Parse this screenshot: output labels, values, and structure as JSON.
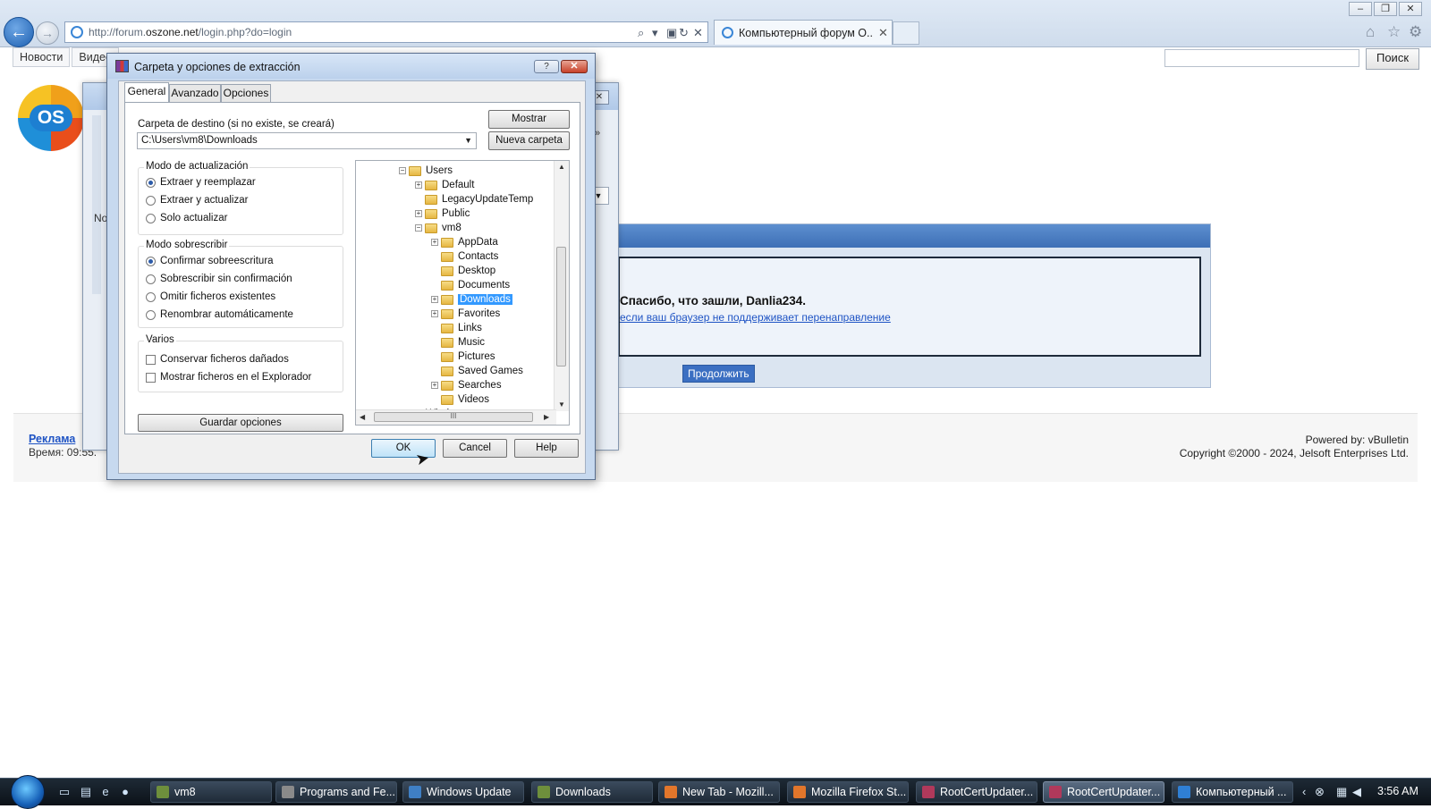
{
  "browser": {
    "url_prefix": "http://forum.",
    "url_domain": "oszone.net",
    "url_path": "/login.php?do=login",
    "tab_title": "Компьютерный форум О...",
    "tab_close": "✕"
  },
  "site": {
    "nav_items": [
      "Новости",
      "Видео"
    ],
    "search_button": "Поиск",
    "logo_text": "OS",
    "thanks_text": "Спасибо, что зашли, Danlia234.",
    "redirect_link": "если ваш браузер не поддерживает перенаправление",
    "continue_button": "Продолжить",
    "footer_ad": "Реклама",
    "footer_time": "Время: 09:55.",
    "footer_powered": "Powered by: vBulletin",
    "footer_copyright": "Copyright ©2000 - 2024, Jelsoft Enterprises Ltd."
  },
  "bg_window": {
    "label_no": "No"
  },
  "dialog": {
    "title": "Carpeta y opciones de extracción",
    "help_glyph": "?",
    "close_glyph": "✕",
    "tabs": [
      "General",
      "Avanzado",
      "Opciones"
    ],
    "dest_label": "Carpeta de destino (si no existe, se creará)",
    "dest_value": "C:\\Users\\vm8\\Downloads",
    "show_button": "Mostrar",
    "new_folder_button": "Nueva carpeta",
    "update_mode": {
      "title": "Modo de actualización",
      "options": [
        "Extraer y reemplazar",
        "Extraer y actualizar",
        "Solo actualizar"
      ],
      "selected": 0
    },
    "overwrite_mode": {
      "title": "Modo sobrescribir",
      "options": [
        "Confirmar sobreescritura",
        "Sobrescribir sin confirmación",
        "Omitir ficheros existentes",
        "Renombrar automáticamente"
      ],
      "selected": 0
    },
    "misc": {
      "title": "Varios",
      "options": [
        "Conservar ficheros dañados",
        "Mostrar ficheros en el Explorador"
      ]
    },
    "save_options_button": "Guardar opciones",
    "tree": {
      "nodes": [
        {
          "label": "Users",
          "level": 0,
          "expander": "−"
        },
        {
          "label": "Default",
          "level": 1,
          "expander": "+"
        },
        {
          "label": "LegacyUpdateTemp",
          "level": 1,
          "expander": ""
        },
        {
          "label": "Public",
          "level": 1,
          "expander": "+"
        },
        {
          "label": "vm8",
          "level": 1,
          "expander": "−"
        },
        {
          "label": "AppData",
          "level": 2,
          "expander": "+"
        },
        {
          "label": "Contacts",
          "level": 2,
          "expander": ""
        },
        {
          "label": "Desktop",
          "level": 2,
          "expander": ""
        },
        {
          "label": "Documents",
          "level": 2,
          "expander": ""
        },
        {
          "label": "Downloads",
          "level": 2,
          "expander": "+",
          "selected": true
        },
        {
          "label": "Favorites",
          "level": 2,
          "expander": "+"
        },
        {
          "label": "Links",
          "level": 2,
          "expander": ""
        },
        {
          "label": "Music",
          "level": 2,
          "expander": ""
        },
        {
          "label": "Pictures",
          "level": 2,
          "expander": ""
        },
        {
          "label": "Saved Games",
          "level": 2,
          "expander": ""
        },
        {
          "label": "Searches",
          "level": 2,
          "expander": "+"
        },
        {
          "label": "Videos",
          "level": 2,
          "expander": ""
        },
        {
          "label": "Windows",
          "level": 0,
          "expander": "+"
        }
      ],
      "hscroll_grip": "III"
    },
    "ok_button": "OK",
    "cancel_button": "Cancel",
    "help_button": "Help"
  },
  "taskbar": {
    "items": [
      {
        "label": "vm8",
        "icon_color": "#6e8f3c"
      },
      {
        "label": "Programs and Fe...",
        "icon_color": "#8a8a8a"
      },
      {
        "label": "Windows Update",
        "icon_color": "#3f7fc4"
      },
      {
        "label": "Downloads",
        "icon_color": "#6e8f3c"
      },
      {
        "label": "New Tab - Mozill...",
        "icon_color": "#e2762b"
      },
      {
        "label": "Mozilla Firefox St...",
        "icon_color": "#e2762b"
      },
      {
        "label": "RootCertUpdater...",
        "icon_color": "#b0395b"
      },
      {
        "label": "RootCertUpdater...",
        "icon_color": "#b0395b",
        "active": true
      },
      {
        "label": "Компьютерный ...",
        "icon_color": "#2f7fd4"
      }
    ],
    "clock": "3:56 AM"
  }
}
